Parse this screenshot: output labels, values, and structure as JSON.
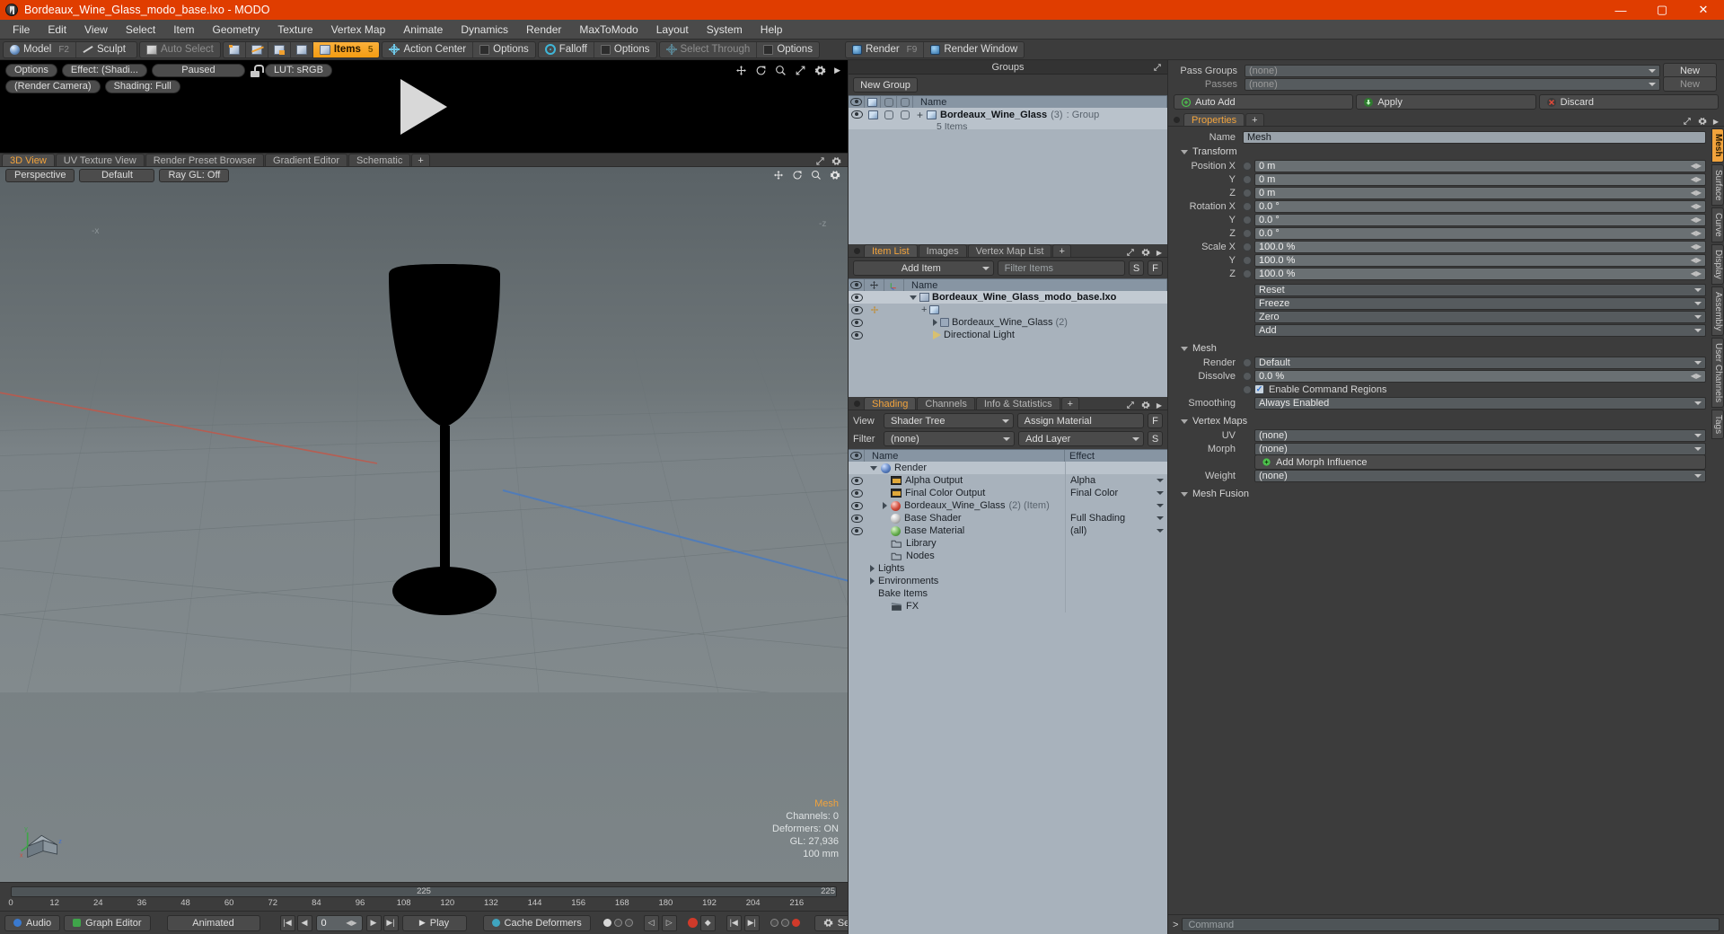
{
  "window": {
    "title": "Bordeaux_Wine_Glass_modo_base.lxo - MODO",
    "minimize": "—",
    "maximize": "▢",
    "close": "✕"
  },
  "menubar": [
    "File",
    "Edit",
    "View",
    "Select",
    "Item",
    "Geometry",
    "Texture",
    "Vertex Map",
    "Animate",
    "Dynamics",
    "Render",
    "MaxToModo",
    "Layout",
    "System",
    "Help"
  ],
  "toolbar": {
    "model": "Model",
    "model_key": "F2",
    "sculpt": "Sculpt",
    "auto_select": "Auto Select",
    "items": "Items",
    "items_key": "5",
    "action_center": "Action Center",
    "options1": "Options",
    "falloff": "Falloff",
    "options2": "Options",
    "select_through": "Select Through",
    "options3": "Options",
    "render": "Render",
    "render_key": "F9",
    "render_window": "Render Window"
  },
  "render_preview": {
    "options": "Options",
    "effect": "Effect: (Shadi...",
    "paused": "Paused",
    "lut": "LUT: sRGB",
    "camera": "(Render Camera)",
    "shading": "Shading: Full"
  },
  "viewport_tabs": {
    "tabs": [
      "3D View",
      "UV Texture View",
      "Render Preset Browser",
      "Gradient Editor",
      "Schematic"
    ],
    "active": "3D View",
    "plus": "+"
  },
  "viewport": {
    "perspective": "Perspective",
    "default": "Default",
    "raygl": "Ray GL: Off",
    "axis_x": "-x",
    "axis_z": "-z",
    "gizmo_x": "x",
    "gizmo_y": "y",
    "gizmo_z": "z",
    "stats": {
      "title": "Mesh",
      "channels": "Channels: 0",
      "deformers": "Deformers: ON",
      "gl": "GL: 27,936",
      "scale": "100 mm"
    }
  },
  "timeline": {
    "ticks": [
      "0",
      "12",
      "24",
      "36",
      "48",
      "60",
      "72",
      "84",
      "96",
      "108",
      "120",
      "132",
      "144",
      "156",
      "168",
      "180",
      "192",
      "204",
      "216"
    ],
    "mid": "225",
    "end": "225"
  },
  "bottombar": {
    "audio": "Audio",
    "graph_editor": "Graph Editor",
    "animated": "Animated",
    "frame_value": "0",
    "play": "Play",
    "cache_deformers": "Cache Deformers",
    "settings": "Settings"
  },
  "groups_panel": {
    "header": "Groups",
    "new_group": "New Group",
    "col_name": "Name",
    "item": "Bordeaux_Wine_Glass",
    "item_count": "(3)",
    "item_type": ": Group",
    "item_sub": "5 Items"
  },
  "item_list": {
    "tabs": [
      "Item List",
      "Images",
      "Vertex Map List"
    ],
    "active": "Item List",
    "plus": "+",
    "add_item": "Add Item",
    "filter_placeholder": "Filter Items",
    "btn_s": "S",
    "btn_f": "F",
    "col_name": "Name",
    "rows": [
      {
        "label": "Bordeaux_Wine_Glass_modo_base.lxo",
        "suffix": "",
        "indent": 0,
        "bold": true
      },
      {
        "label": "",
        "suffix": "",
        "indent": 1,
        "bold": false
      },
      {
        "label": "Bordeaux_Wine_Glass",
        "suffix": "(2)",
        "indent": 2,
        "bold": false
      },
      {
        "label": "Directional Light",
        "suffix": "",
        "indent": 2,
        "bold": false
      }
    ]
  },
  "shading_panel": {
    "tabs": [
      "Shading",
      "Channels",
      "Info & Statistics"
    ],
    "active": "Shading",
    "plus": "+",
    "view_label": "View",
    "view_value": "Shader Tree",
    "assign_material": "Assign Material",
    "btn_f": "F",
    "filter_label": "Filter",
    "filter_value": "(none)",
    "add_layer": "Add Layer",
    "btn_s": "S",
    "col_name": "Name",
    "col_effect": "Effect",
    "rows": [
      {
        "name": "Render",
        "suffix": "",
        "effect": "",
        "indent": 0,
        "icon": "sphere-blue",
        "eye": false,
        "arrow": "down"
      },
      {
        "name": "Alpha Output",
        "suffix": "",
        "effect": "Alpha",
        "indent": 1,
        "icon": "image-node",
        "eye": true,
        "arrow": ""
      },
      {
        "name": "Final Color Output",
        "suffix": "",
        "effect": "Final Color",
        "indent": 1,
        "icon": "image-node",
        "eye": true,
        "arrow": ""
      },
      {
        "name": "Bordeaux_Wine_Glass",
        "suffix": "(2) (Item)",
        "effect": "",
        "indent": 1,
        "icon": "sphere-red",
        "eye": true,
        "arrow": "right"
      },
      {
        "name": "Base Shader",
        "suffix": "",
        "effect": "Full Shading",
        "indent": 1,
        "icon": "sphere-grey",
        "eye": true,
        "arrow": ""
      },
      {
        "name": "Base Material",
        "suffix": "",
        "effect": "(all)",
        "indent": 1,
        "icon": "sphere-green",
        "eye": true,
        "arrow": ""
      },
      {
        "name": "Library",
        "suffix": "",
        "effect": "",
        "indent": 1,
        "icon": "folder",
        "eye": false,
        "arrow": ""
      },
      {
        "name": "Nodes",
        "suffix": "",
        "effect": "",
        "indent": 1,
        "icon": "folder",
        "eye": false,
        "arrow": ""
      },
      {
        "name": "Lights",
        "suffix": "",
        "effect": "",
        "indent": 0,
        "icon": "none",
        "eye": false,
        "arrow": "right"
      },
      {
        "name": "Environments",
        "suffix": "",
        "effect": "",
        "indent": 0,
        "icon": "none",
        "eye": false,
        "arrow": "right"
      },
      {
        "name": "Bake Items",
        "suffix": "",
        "effect": "",
        "indent": 0,
        "icon": "none",
        "eye": false,
        "arrow": ""
      },
      {
        "name": "FX",
        "suffix": "",
        "effect": "",
        "indent": 1,
        "icon": "clapper",
        "eye": false,
        "arrow": ""
      }
    ]
  },
  "passes": {
    "pass_groups_label": "Pass Groups",
    "pass_groups_value": "(none)",
    "pass_groups_new": "New",
    "passes_label": "Passes",
    "passes_value": "(none)",
    "passes_new": "New",
    "auto_add": "Auto Add",
    "apply": "Apply",
    "discard": "Discard"
  },
  "properties": {
    "tabs": [
      "Properties"
    ],
    "active": "Properties",
    "plus": "+",
    "name_label": "Name",
    "name_value": "Mesh",
    "transform_section": "Transform",
    "transform_rows": [
      {
        "label": "Position X",
        "value": "0 m"
      },
      {
        "label": "Y",
        "value": "0 m"
      },
      {
        "label": "Z",
        "value": "0 m"
      },
      {
        "label": "Rotation X",
        "value": "0.0 °"
      },
      {
        "label": "Y",
        "value": "0.0 °"
      },
      {
        "label": "Z",
        "value": "0.0 °"
      },
      {
        "label": "Scale X",
        "value": "100.0 %"
      },
      {
        "label": "Y",
        "value": "100.0 %"
      },
      {
        "label": "Z",
        "value": "100.0 %"
      }
    ],
    "transform_actions": [
      "Reset",
      "Freeze",
      "Zero",
      "Add"
    ],
    "mesh_section": "Mesh",
    "mesh_render_label": "Render",
    "mesh_render_value": "Default",
    "mesh_dissolve_label": "Dissolve",
    "mesh_dissolve_value": "0.0 %",
    "enable_command_regions": "Enable Command Regions",
    "smoothing_label": "Smoothing",
    "smoothing_value": "Always Enabled",
    "vertex_maps_section": "Vertex Maps",
    "uv_label": "UV",
    "uv_value": "(none)",
    "morph_label": "Morph",
    "morph_value": "(none)",
    "add_morph_influence": "Add Morph Influence",
    "weight_label": "Weight",
    "weight_value": "(none)",
    "mesh_fusion_section": "Mesh Fusion",
    "side_tabs": [
      "Mesh",
      "Surface",
      "Curve",
      "Display",
      "Assembly",
      "User Channels",
      "Tags"
    ],
    "side_active": "Mesh"
  },
  "command_bar": {
    "prompt": ">",
    "placeholder": "Command"
  },
  "colors": {
    "accent_orange": "#f2a33c",
    "title_bar": "#e03d00",
    "panel_bg": "#3c3c3c",
    "list_bg": "#a8b2bc",
    "list_header": "#8795a3"
  }
}
